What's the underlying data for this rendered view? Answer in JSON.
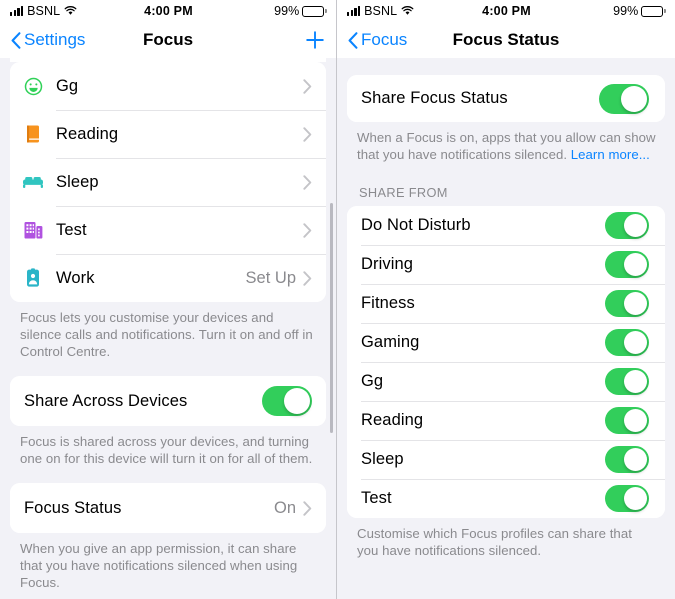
{
  "status_bar": {
    "carrier": "BSNL",
    "time": "4:00 PM",
    "battery_pct": "99%",
    "signal_icon": "cellular-bars-icon",
    "wifi_icon": "wifi-icon",
    "battery_icon": "battery-icon"
  },
  "colors": {
    "accent_blue": "#0a84ff",
    "toggle_green": "#32ce5b",
    "page_background": "#f2f2f7",
    "card_background": "#ffffff",
    "secondary_text": "#8a8a8e"
  },
  "left_screen": {
    "nav": {
      "back_label": "Settings",
      "title": "Focus",
      "add_icon": "plus-icon"
    },
    "focus_list": [
      {
        "label": "Gg",
        "icon": "smiley-face-icon",
        "icon_color": "#30d158",
        "value": ""
      },
      {
        "label": "Reading",
        "icon": "book-icon",
        "icon_color": "#f7931e",
        "value": ""
      },
      {
        "label": "Sleep",
        "icon": "bed-icon",
        "icon_color": "#30c5c0",
        "value": ""
      },
      {
        "label": "Test",
        "icon": "buildings-icon",
        "icon_color": "#b052e0",
        "value": ""
      },
      {
        "label": "Work",
        "icon": "id-badge-icon",
        "icon_color": "#2ab5c8",
        "value": "Set Up"
      }
    ],
    "focus_footnote": "Focus lets you customise your devices and silence calls and notifications. Turn it on and off in Control Centre.",
    "share_across_devices": {
      "label": "Share Across Devices",
      "toggle_on": true
    },
    "share_across_devices_footnote": "Focus is shared across your devices, and turning one on for this device will turn it on for all of them.",
    "focus_status_row": {
      "label": "Focus Status",
      "value": "On"
    },
    "focus_status_footnote": "When you give an app permission, it can share that you have notifications silenced when using Focus."
  },
  "right_screen": {
    "nav": {
      "back_label": "Focus",
      "title": "Focus Status"
    },
    "share_focus_status": {
      "label": "Share Focus Status",
      "toggle_on": true
    },
    "share_focus_status_footnote_1": "When a Focus is on, apps that you allow can show",
    "share_focus_status_footnote_2": "that you have notifications silenced. ",
    "learn_more_label": "Learn more...",
    "group_header": "SHARE FROM",
    "share_from_list": [
      {
        "label": "Do Not Disturb",
        "toggle_on": true
      },
      {
        "label": "Driving",
        "toggle_on": true
      },
      {
        "label": "Fitness",
        "toggle_on": true
      },
      {
        "label": "Gaming",
        "toggle_on": true
      },
      {
        "label": "Gg",
        "toggle_on": true
      },
      {
        "label": "Reading",
        "toggle_on": true
      },
      {
        "label": "Sleep",
        "toggle_on": true
      },
      {
        "label": "Test",
        "toggle_on": true
      }
    ],
    "share_from_footnote": "Customise which Focus profiles can share that you have notifications silenced."
  }
}
